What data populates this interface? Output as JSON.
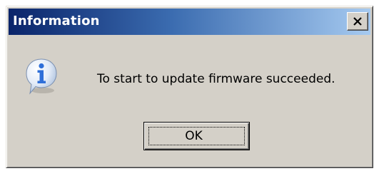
{
  "dialog": {
    "title": "Information",
    "message": "To start to update firmware succeeded.",
    "ok_label": "OK",
    "icon": "information-icon"
  },
  "colors": {
    "titlebar_start": "#0a246a",
    "titlebar_end": "#a6caf0",
    "face": "#d4d0c8",
    "icon_blue": "#2f6fd8"
  }
}
